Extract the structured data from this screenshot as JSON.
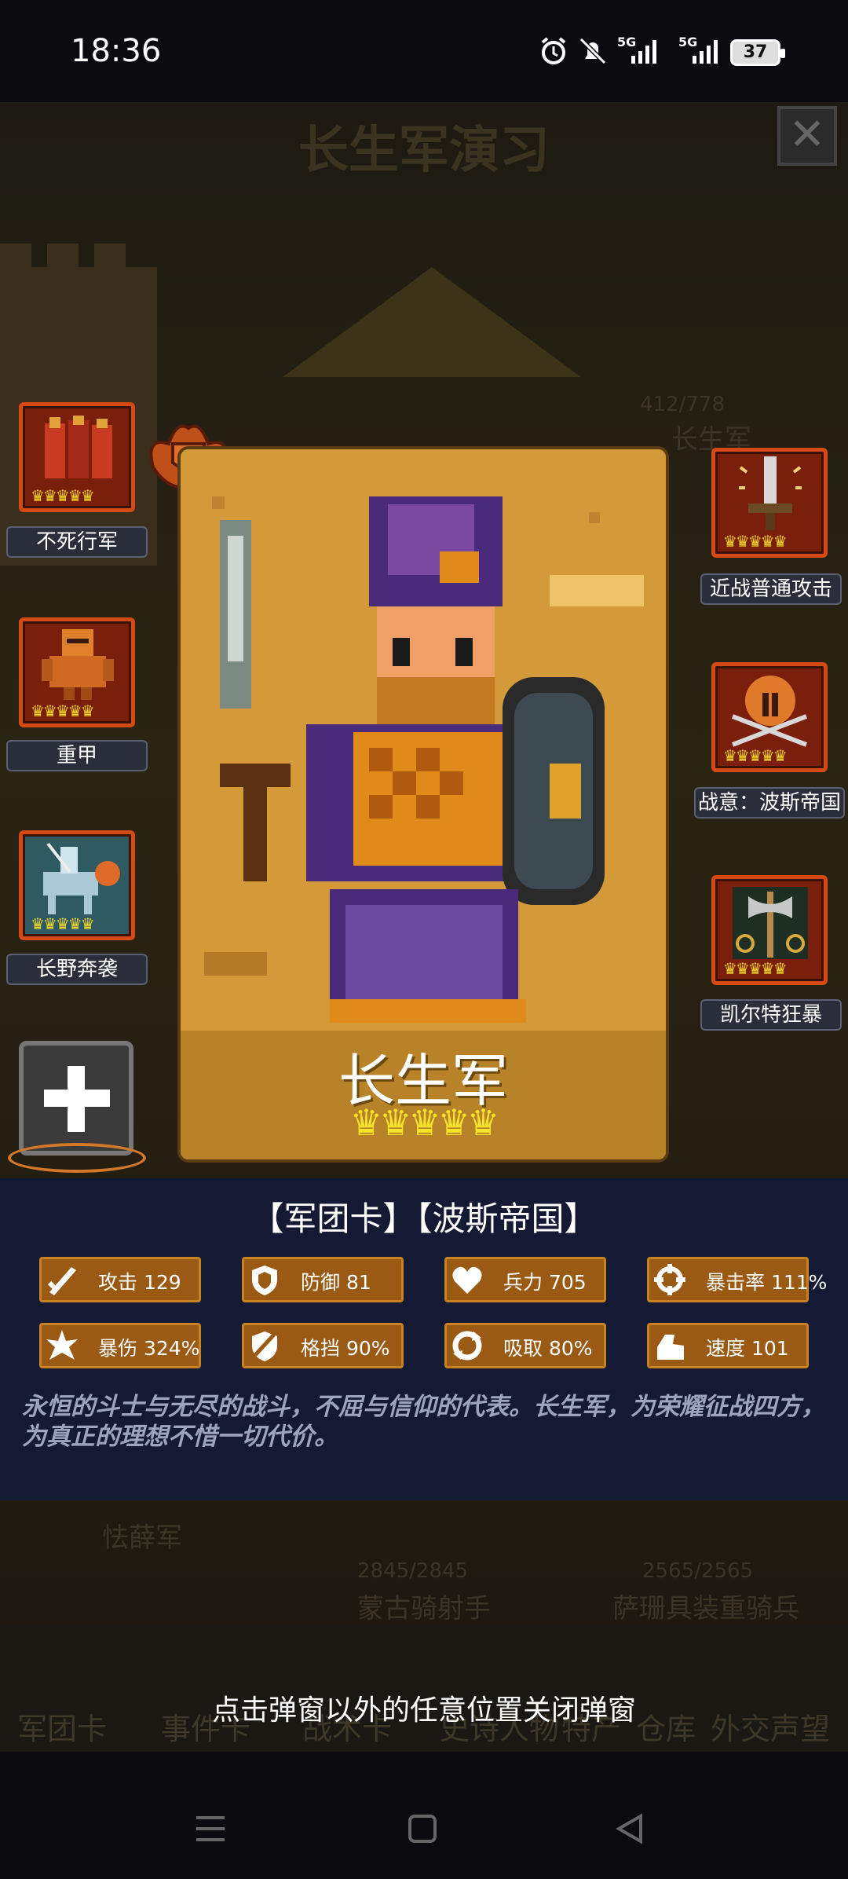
{
  "status_bar": {
    "time": "18:36",
    "battery": "37",
    "network1": "5G",
    "network2": "5G"
  },
  "background": {
    "title": "长生军演习",
    "close_icon": "close-icon",
    "unit_counter": "412/778",
    "unit_name": "长生军",
    "left_unit": "怯薛军",
    "mid_counter": "2845/2845",
    "mid_unit": "蒙古骑射手",
    "right_counter": "2565/2565",
    "right_unit": "萨珊具装重骑兵",
    "nav": [
      "军团卡",
      "事件卡",
      "战术卡",
      "史诗人物",
      "特产",
      "仓库",
      "外交声望"
    ]
  },
  "close_hint": "点击弹窗以外的任意位置关闭弹窗",
  "left_skills": [
    {
      "label": "不死行军",
      "icon": "undead-march-icon"
    },
    {
      "label": "重甲",
      "icon": "heavy-armor-icon"
    },
    {
      "label": "长野奔袭",
      "icon": "long-raid-icon"
    }
  ],
  "right_skills": [
    {
      "label": "近战普通攻击",
      "icon": "sword-icon"
    },
    {
      "label": "战意：波斯帝国",
      "icon": "spartan-helmet-icon"
    },
    {
      "label": "凯尔特狂暴",
      "icon": "celtic-axe-icon"
    }
  ],
  "add_button": {
    "icon": "plus-icon"
  },
  "card": {
    "name": "长生军",
    "stars": 5,
    "crowns": "♛♛♛♛♛"
  },
  "info": {
    "header": "【军团卡】【波斯帝国】",
    "stats": [
      {
        "label": "攻击 129",
        "icon": "attack-icon"
      },
      {
        "label": "防御 81",
        "icon": "defense-icon"
      },
      {
        "label": "兵力 705",
        "icon": "heart-icon"
      },
      {
        "label": "暴击率 111%",
        "icon": "crit-rate-icon"
      },
      {
        "label": "暴伤 324%",
        "icon": "crit-damage-icon"
      },
      {
        "label": "格挡 90%",
        "icon": "block-icon"
      },
      {
        "label": "吸取 80%",
        "icon": "lifesteal-icon"
      },
      {
        "label": "速度 101",
        "icon": "speed-icon"
      }
    ],
    "flavor": "永恒的斗士与无尽的战斗，不屈与信仰的代表。长生军，为荣耀征战四方，为真正的理想不惜一切代价。"
  },
  "colors": {
    "panel": "#141a33",
    "card": "#d49a3a",
    "stat_bg": "#9a5a14",
    "skill_border": "#d44a12"
  }
}
